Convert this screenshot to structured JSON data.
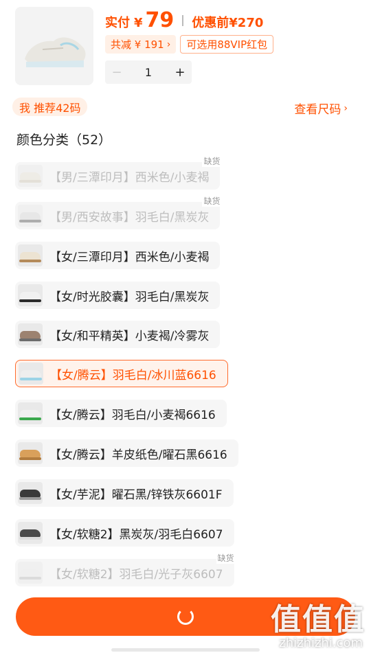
{
  "product": {
    "paid_label": "实付",
    "currency": "¥",
    "price": "79",
    "before_label": "优惠前¥270",
    "discount_label": "共减 ¥ 191",
    "coupon_label": "可选用88VIP红包",
    "quantity": "1",
    "minus": "−",
    "plus": "+"
  },
  "recommend": {
    "label": "我 推荐42码",
    "size_link": "查看尺码"
  },
  "section": {
    "title": "颜色分类（52）"
  },
  "options": [
    {
      "label": "【男/三潭印月】西米色/小麦褐",
      "state": "disabled",
      "badge": "缺货",
      "shoe": "#e6e0d4",
      "sole": "#cfc6b5"
    },
    {
      "label": "【男/西安故事】羽毛白/黑炭灰",
      "state": "disabled",
      "badge": "缺货",
      "shoe": "#d7d7d7",
      "sole": "#555555"
    },
    {
      "label": "【女/三潭印月】西米色/小麦褐",
      "state": "normal",
      "badge": "",
      "shoe": "#ece3d2",
      "sole": "#b48a5a"
    },
    {
      "label": "【女/时光胶囊】羽毛白/黑炭灰",
      "state": "normal",
      "badge": "",
      "shoe": "#f1f1f1",
      "sole": "#2b2b2b"
    },
    {
      "label": "【女/和平精英】小麦褐/冷雾灰",
      "state": "normal",
      "badge": "",
      "shoe": "#9c8270",
      "sole": "#6c6c6c"
    },
    {
      "label": "【女/腾云】羽毛白/冰川蓝6616",
      "state": "selected",
      "badge": "",
      "shoe": "#eeeeee",
      "sole": "#9cd3e6"
    },
    {
      "label": "【女/腾云】羽毛白/小麦褐6616",
      "state": "normal",
      "badge": "",
      "shoe": "#f0f0f0",
      "sole": "#3aa84d"
    },
    {
      "label": "【女/腾云】羊皮纸色/曜石黑6616",
      "state": "normal",
      "badge": "",
      "shoe": "#d9a05b",
      "sole": "#b27c3e"
    },
    {
      "label": "【女/芋泥】曜石黑/锌铁灰6601F",
      "state": "normal",
      "badge": "",
      "shoe": "#3a3a3a",
      "sole": "#9a9a9a"
    },
    {
      "label": "【女/软糖2】黑炭灰/羽毛白6607",
      "state": "normal",
      "badge": "",
      "shoe": "#4a4a4a",
      "sole": "#dddddd"
    },
    {
      "label": "【女/软糖2】羽毛白/光子灰6607",
      "state": "disabled",
      "badge": "缺货",
      "shoe": "#e8e8e8",
      "sole": "#bcbcbc"
    }
  ],
  "watermark": {
    "text": "值值值",
    "url": "zhizhizhi.com"
  },
  "colors": {
    "accent": "#ff5000",
    "cta": "#ff5a14"
  }
}
